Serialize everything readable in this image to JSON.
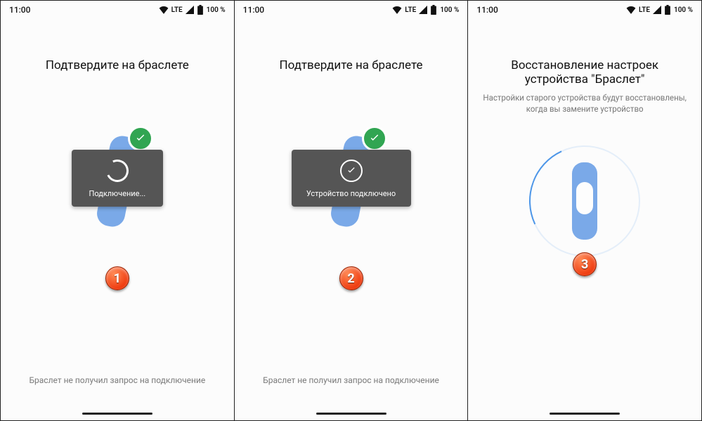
{
  "status": {
    "time": "11:00",
    "network": "LTE",
    "battery": "100 %"
  },
  "screens": [
    {
      "title": "Подтвердите на браслете",
      "subtitle": "",
      "toast": "Подключение...",
      "footer": "Браслет не получил запрос на подключение",
      "step": "1"
    },
    {
      "title": "Подтвердите на браслете",
      "subtitle": "",
      "toast": "Устройство подключено",
      "footer": "Браслет не получил запрос на подключение",
      "step": "2"
    },
    {
      "title": "Восстановление настроек устройства \"Браслет\"",
      "subtitle": "Настройки старого устройства будут восстановлены, когда вы замените устройство",
      "toast": "",
      "footer": "",
      "step": "3"
    }
  ]
}
